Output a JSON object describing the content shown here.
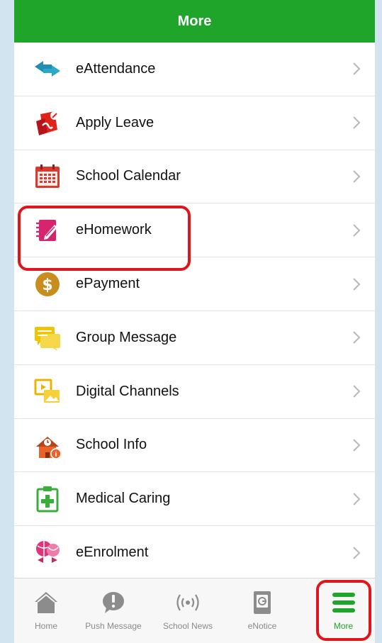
{
  "header": {
    "title": "More"
  },
  "menu": [
    {
      "label": "eAttendance",
      "icon": "arrows-exchange-icon"
    },
    {
      "label": "Apply Leave",
      "icon": "leave-form-icon"
    },
    {
      "label": "School Calendar",
      "icon": "calendar-icon"
    },
    {
      "label": "eHomework",
      "icon": "notebook-pencil-icon",
      "highlighted": true
    },
    {
      "label": "ePayment",
      "icon": "dollar-coin-icon"
    },
    {
      "label": "Group Message",
      "icon": "message-bubbles-icon"
    },
    {
      "label": "Digital Channels",
      "icon": "media-frames-icon"
    },
    {
      "label": "School Info",
      "icon": "school-building-icon"
    },
    {
      "label": "Medical Caring",
      "icon": "medical-clipboard-icon"
    },
    {
      "label": "eEnrolment",
      "icon": "sports-balls-icon"
    }
  ],
  "tabbar": [
    {
      "label": "Home",
      "icon": "home-icon"
    },
    {
      "label": "Push Message",
      "icon": "alert-bubble-icon"
    },
    {
      "label": "School News",
      "icon": "broadcast-icon"
    },
    {
      "label": "eNotice",
      "icon": "notice-document-icon"
    },
    {
      "label": "More",
      "icon": "menu-bars-icon",
      "active": true,
      "highlighted": true
    }
  ],
  "colors": {
    "brand": "#1fa52a",
    "highlight": "#e0141b",
    "tab_inactive": "#8a8a8a"
  }
}
